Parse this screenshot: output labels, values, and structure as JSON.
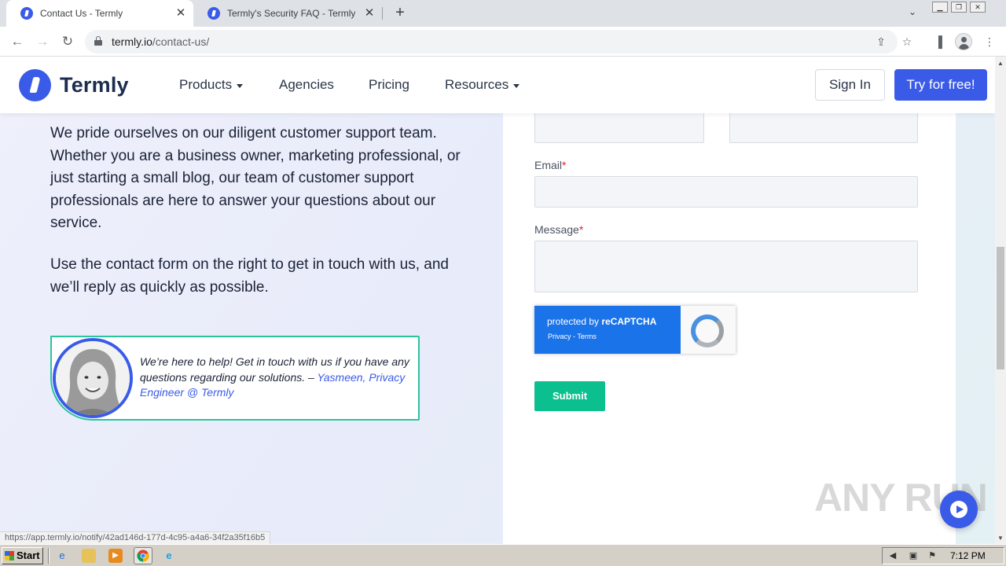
{
  "browser": {
    "tabs": [
      {
        "title": "Contact Us - Termly",
        "active": true
      },
      {
        "title": "Termly's Security FAQ - Termly",
        "active": false
      }
    ],
    "new_tab_symbol": "+",
    "url_host": "termly.io",
    "url_path": "/contact-us/",
    "status_url": "https://app.termly.io/notify/42ad146d-177d-4c95-a4a6-34f2a35f16b5"
  },
  "site": {
    "logo_text": "Termly",
    "brand_color": "#3a5be8",
    "accent_color": "#0cbf8e",
    "nav": {
      "products": "Products",
      "agencies": "Agencies",
      "pricing": "Pricing",
      "resources": "Resources"
    },
    "sign_in": "Sign In",
    "try_free": "Try for free!"
  },
  "content": {
    "intro": "We pride ourselves on our diligent customer support team. Whether you are a business owner, marketing professional, or just starting a small blog, our team of customer support professionals are here to answer your questions about our service.",
    "intro2": "Use the contact form on the right to get in touch with us, and we’ll reply as quickly as possible.",
    "quote": "We’re here to help! Get in touch with us if you have any questions regarding our solutions. – ",
    "quote_author": "Yasmeen, Privacy Engineer @ Termly"
  },
  "form": {
    "email_label": "Email",
    "message_label": "Message",
    "required_mark": "*",
    "email_value": "",
    "message_value": "",
    "recaptcha_prefix": "protected by ",
    "recaptcha_brand": "reCAPTCHA",
    "recaptcha_links": "Privacy - Terms",
    "submit_label": "Submit"
  },
  "watermark": "ANY RUN",
  "taskbar": {
    "start_label": "Start",
    "clock": "7:12 PM"
  }
}
